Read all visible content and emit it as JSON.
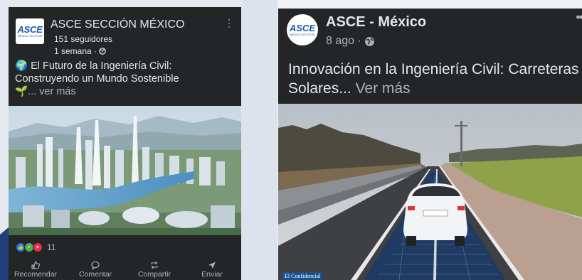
{
  "colors": {
    "card_bg": "#242526",
    "text_primary": "#e4e6eb",
    "text_secondary": "#b0b3b8",
    "asce_blue": "#1a5ba8"
  },
  "left_post": {
    "logo_text": "ASCE",
    "logo_subtext": "MÉXICO SECTION",
    "page_name": "ASCE SECCIÓN MÉXICO",
    "followers": "151 seguidores",
    "time": "1 semana ·",
    "privacy_icon": "globe-icon",
    "more_icon": "kebab-icon",
    "text_emoji": "🌍",
    "text_body": "El Futuro de la Ingeniería Civil: Construyendo un Mundo Sostenible",
    "text_emoji_2": "🌱",
    "see_more": "... ver más",
    "image_description_icon": "futuristic-city-image",
    "reaction_count": "11",
    "actions": [
      {
        "icon": "like-icon",
        "label": "Recomendar"
      },
      {
        "icon": "comment-icon",
        "label": "Comentar"
      },
      {
        "icon": "share-icon",
        "label": "Compartir"
      },
      {
        "icon": "send-icon",
        "label": "Enviar"
      }
    ]
  },
  "right_post": {
    "logo_text": "ASCE",
    "logo_subtext": "MÉXICO SECTION",
    "page_name": "ASCE - México",
    "time": "8 ago ·",
    "privacy_icon": "globe-icon",
    "more_icon": "ellipsis-icon",
    "text_body": "Innovación en la Ingeniería Civil: Carreteras Solares...",
    "see_more": "Ver más",
    "image_credit": "El Confidencial"
  }
}
